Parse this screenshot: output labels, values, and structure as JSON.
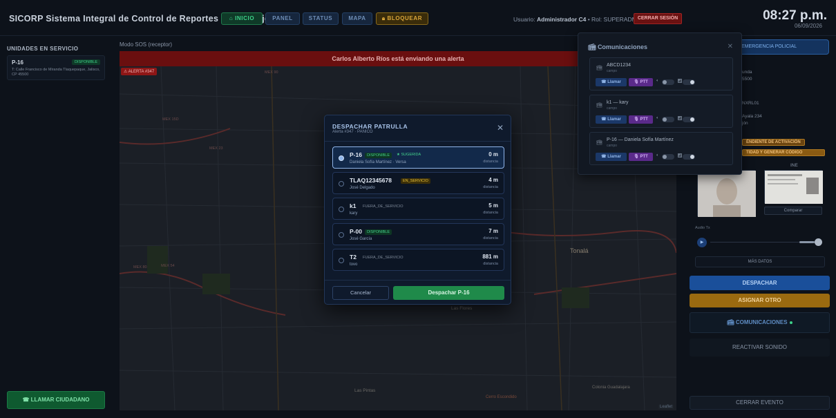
{
  "header": {
    "title": "SICORP Sistema Integral de Control de Reportes y Patrullaje",
    "nav": {
      "inicio": "INICIO",
      "panel": "PANEL",
      "status": "STATUS",
      "mapa": "MAPA",
      "bloquear": "BLOQUEAR"
    },
    "user_prefix": "Usuario: ",
    "user_name": "Administrador C4",
    "role_text": " • Rol: SUPERADMIN",
    "logout": "CERRAR SESIÓN",
    "clock": "08:27 p.m.",
    "date": "06/09/2026"
  },
  "sidebar": {
    "title": "UNIDADES EN SERVICIO",
    "unit": {
      "code": "P-16",
      "status": "DISPONIBLE",
      "address": "T: Calle Francisco de Miranda Tlaquepaque, Jalisco, CP 45500"
    },
    "call_citizen": "LLAMAR CIUDADANO"
  },
  "map": {
    "mode_label": "Modo SOS (receptor)",
    "alert_text": "Carlos Alberto Ríos está enviando una alerta",
    "alert_chip": "ALERTA #347",
    "labels": [
      "Tonalá",
      "San Martín de Las Flores",
      "Las Pintas",
      "Colonia Guadalajara",
      "Cerro Escondido",
      "MEX 23",
      "MEX 80",
      "MEX 15D",
      "MEX 54",
      "MEX 90"
    ],
    "leaflet": "Leaflet"
  },
  "right_panel": {
    "emergency": "EMERGENCIA POLICIAL",
    "partial_lines": [
      "unda",
      "5500",
      "NXRL01",
      "Ayala 234",
      "jón",
      "ÉNDIENTE DE ACTIVACIÓN",
      "TIDAD Y GENERAR CÓDIGO"
    ],
    "ine_label": "INE",
    "compare": "Comparar",
    "audio_label": "Audio Tx",
    "more_data": "MÁS DATOS",
    "dispatch": "DESPACHAR",
    "assign_other": "ASIGNAR OTRO",
    "comms": "COMUNICACIONES",
    "reactivate": "REACTIVAR SONIDO",
    "close_event": "CERRAR EVENTO"
  },
  "comms_panel": {
    "title": "Comunicaciones",
    "items": [
      {
        "name": "ABCD1234",
        "sub": "campo",
        "call": "Llamar",
        "ptt": "PTT"
      },
      {
        "name": "k1 — kary",
        "sub": "campo",
        "call": "Llamar",
        "ptt": "PTT"
      },
      {
        "name": "P-16 — Daniela Sofía Martínez",
        "sub": "campo",
        "call": "Llamar",
        "ptt": "PTT"
      }
    ]
  },
  "modal": {
    "title": "DESPACHAR PATRULLA",
    "subtitle": "Alerta #347 · PANICO",
    "distance_label": "distancia",
    "options": [
      {
        "code": "P-16",
        "status": "DISPONIBLE",
        "status_kind": "green",
        "suggested": "SUGERIDA",
        "person": "Daniela Sofía Martínez · Versa",
        "distance": "0 m"
      },
      {
        "code": "TLAQ12345678",
        "status": "EN_SERVICIO",
        "status_kind": "yellow",
        "person": "José Delgado",
        "distance": "4 m"
      },
      {
        "code": "k1",
        "status": "FUERA_DE_SERVICIO",
        "status_kind": "gray",
        "person": "kary",
        "distance": "5 m"
      },
      {
        "code": "P-00",
        "status": "DISPONIBLE",
        "status_kind": "green",
        "person": "José García",
        "distance": "7 m"
      },
      {
        "code": "T2",
        "status": "FUERA_DE_SERVICIO",
        "status_kind": "gray",
        "person": "tovo",
        "distance": "881 m"
      }
    ],
    "cancel": "Cancelar",
    "confirm": "Despachar P-16"
  },
  "colors": {
    "accent_green": "#1f8a4a",
    "alert_red": "#6a0f0f",
    "dispatch_blue": "#1a4f9a",
    "assign_amber": "#9a6a10"
  }
}
